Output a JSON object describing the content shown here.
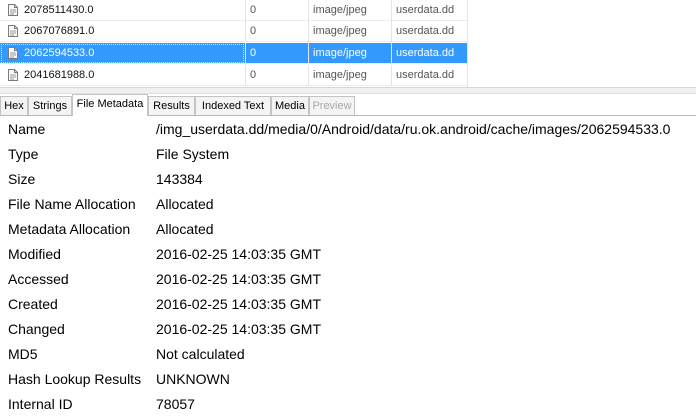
{
  "file_table": {
    "rows": [
      {
        "name": "2078511430.0",
        "size": "0",
        "mime": "image/jpeg",
        "source": "userdata.dd",
        "selected": false
      },
      {
        "name": "2067076891.0",
        "size": "0",
        "mime": "image/jpeg",
        "source": "userdata.dd",
        "selected": false
      },
      {
        "name": "2062594533.0",
        "size": "0",
        "mime": "image/jpeg",
        "source": "userdata.dd",
        "selected": true
      },
      {
        "name": "2041681988.0",
        "size": "0",
        "mime": "image/jpeg",
        "source": "userdata.dd",
        "selected": false
      }
    ]
  },
  "tabs": [
    {
      "label": "Hex",
      "active": false,
      "disabled": false
    },
    {
      "label": "Strings",
      "active": false,
      "disabled": false
    },
    {
      "label": "File Metadata",
      "active": true,
      "disabled": false
    },
    {
      "label": "Results",
      "active": false,
      "disabled": false
    },
    {
      "label": "Indexed Text",
      "active": false,
      "disabled": false
    },
    {
      "label": "Media",
      "active": false,
      "disabled": false
    },
    {
      "label": "Preview",
      "active": false,
      "disabled": true
    }
  ],
  "metadata": [
    {
      "key": "Name",
      "value": "/img_userdata.dd/media/0/Android/data/ru.ok.android/cache/images/2062594533.0"
    },
    {
      "key": "Type",
      "value": "File System"
    },
    {
      "key": "Size",
      "value": "143384"
    },
    {
      "key": "File Name Allocation",
      "value": "Allocated"
    },
    {
      "key": "Metadata Allocation",
      "value": "Allocated"
    },
    {
      "key": "Modified",
      "value": "2016-02-25 14:03:35 GMT"
    },
    {
      "key": "Accessed",
      "value": "2016-02-25 14:03:35 GMT"
    },
    {
      "key": "Created",
      "value": "2016-02-25 14:03:35 GMT"
    },
    {
      "key": "Changed",
      "value": "2016-02-25 14:03:35 GMT"
    },
    {
      "key": "MD5",
      "value": "Not calculated"
    },
    {
      "key": "Hash Lookup Results",
      "value": "UNKNOWN"
    },
    {
      "key": "Internal ID",
      "value": "78057"
    }
  ],
  "colors": {
    "selection": "#3399ff",
    "tab_border": "#c4c4c4",
    "disabled_text": "#a8a8a8"
  },
  "icons": {
    "file_row": "file-icon"
  }
}
